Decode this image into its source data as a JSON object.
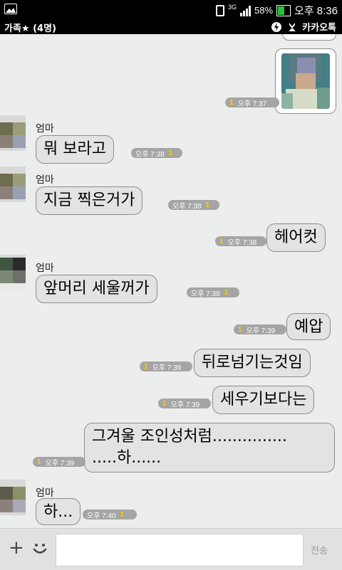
{
  "status": {
    "battery": "58%",
    "time": "오후 8:36",
    "network": "3G"
  },
  "header": {
    "title": "가족★ (4명)",
    "app_name": "카카오톡"
  },
  "messages": [
    {
      "id": "m1",
      "sender": "me",
      "type": "photo",
      "unread": "1",
      "time": "오후 7:37"
    },
    {
      "id": "m2",
      "sender": "엄마",
      "text": "뭐 보라고",
      "unread": "1",
      "time": "오후 7:38"
    },
    {
      "id": "m3",
      "sender": "엄마",
      "text": "지금 찍은거가",
      "unread": "1",
      "time": "오후 7:38"
    },
    {
      "id": "m4",
      "sender": "me",
      "text": "헤어컷",
      "unread": "1",
      "time": "오후 7:38"
    },
    {
      "id": "m5",
      "sender": "엄마",
      "text": "앞머리 세울꺼가",
      "unread": "1",
      "time": "오후 7:38"
    },
    {
      "id": "m6",
      "sender": "me",
      "text": "예압",
      "unread": "1",
      "time": "오후 7:39"
    },
    {
      "id": "m7",
      "sender": "me",
      "text": "뒤로넘기는것임",
      "unread": "1",
      "time": "오후 7:39"
    },
    {
      "id": "m8",
      "sender": "me",
      "text": "세우기보다는",
      "unread": "1",
      "time": "오후 7:39"
    },
    {
      "id": "m9",
      "sender": "me",
      "text_line1": "그겨울 조인성처럼...............",
      "text_line2": ".....하......",
      "unread": "1",
      "time": "오후 7:39"
    },
    {
      "id": "m10",
      "sender": "엄마",
      "text": "하...",
      "unread": "1",
      "time": "오후 7:40"
    }
  ],
  "input": {
    "placeholder": "",
    "send_label": "전송"
  },
  "colors": {
    "bubble": "#e3e3e3",
    "meta_bg": "#a5a5a5",
    "unread": "#f5d200",
    "chat_bg": "#eceded"
  }
}
